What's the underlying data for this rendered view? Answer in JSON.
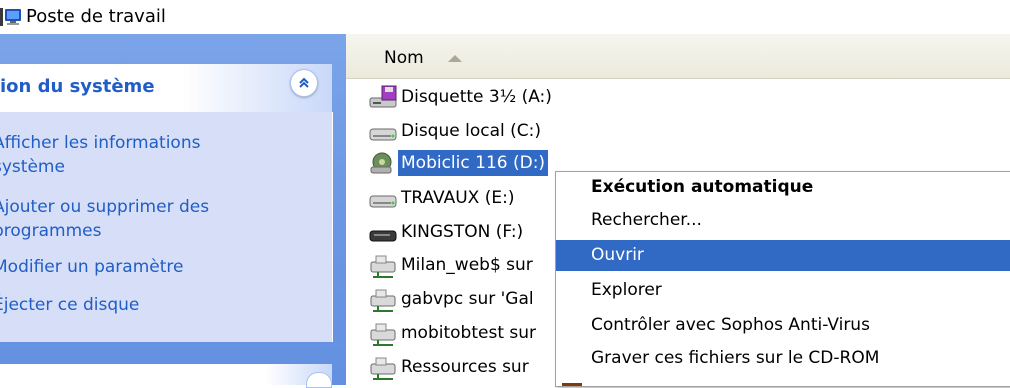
{
  "window": {
    "title": "Poste de travail"
  },
  "task_pane": {
    "section_title": "ion du système",
    "items": [
      {
        "line1": "Afficher les informations",
        "line2": "système"
      },
      {
        "line1": "Ajouter ou supprimer des",
        "line2": "programmes"
      },
      {
        "line1": "Modifier un paramètre"
      },
      {
        "line1": "Éjecter ce disque"
      }
    ]
  },
  "file_list": {
    "column_name": "Nom",
    "rows": [
      {
        "label": "Disquette 3½ (A:)",
        "icon": "floppy-drive-icon"
      },
      {
        "label": "Disque local (C:)",
        "icon": "hard-disk-icon"
      },
      {
        "label": "Mobiclic 116 (D:)",
        "icon": "cd-drive-icon",
        "selected": true
      },
      {
        "label": "TRAVAUX (E:)",
        "icon": "hard-disk-icon"
      },
      {
        "label": "KINGSTON (F:)",
        "icon": "removable-disk-icon"
      },
      {
        "label": "Milan_web$ sur",
        "icon": "network-drive-icon"
      },
      {
        "label": "gabvpc sur 'Gal",
        "icon": "network-drive-icon"
      },
      {
        "label": "mobitobtest sur",
        "icon": "network-drive-icon"
      },
      {
        "label": "Ressources sur",
        "icon": "network-drive-icon"
      }
    ]
  },
  "context_menu": {
    "items": [
      {
        "label": "Exécution automatique",
        "bold": true
      },
      {
        "label": "Rechercher..."
      },
      {
        "label": "Ouvrir",
        "highlighted": true
      },
      {
        "label": "Explorer"
      },
      {
        "label": "Contrôler avec Sophos Anti-Virus"
      },
      {
        "label": "Graver ces fichiers sur le CD-ROM"
      }
    ]
  },
  "colors": {
    "selection": "#316ac5",
    "task_link": "#215dc6",
    "task_pane_bg": "#6c98e4"
  }
}
